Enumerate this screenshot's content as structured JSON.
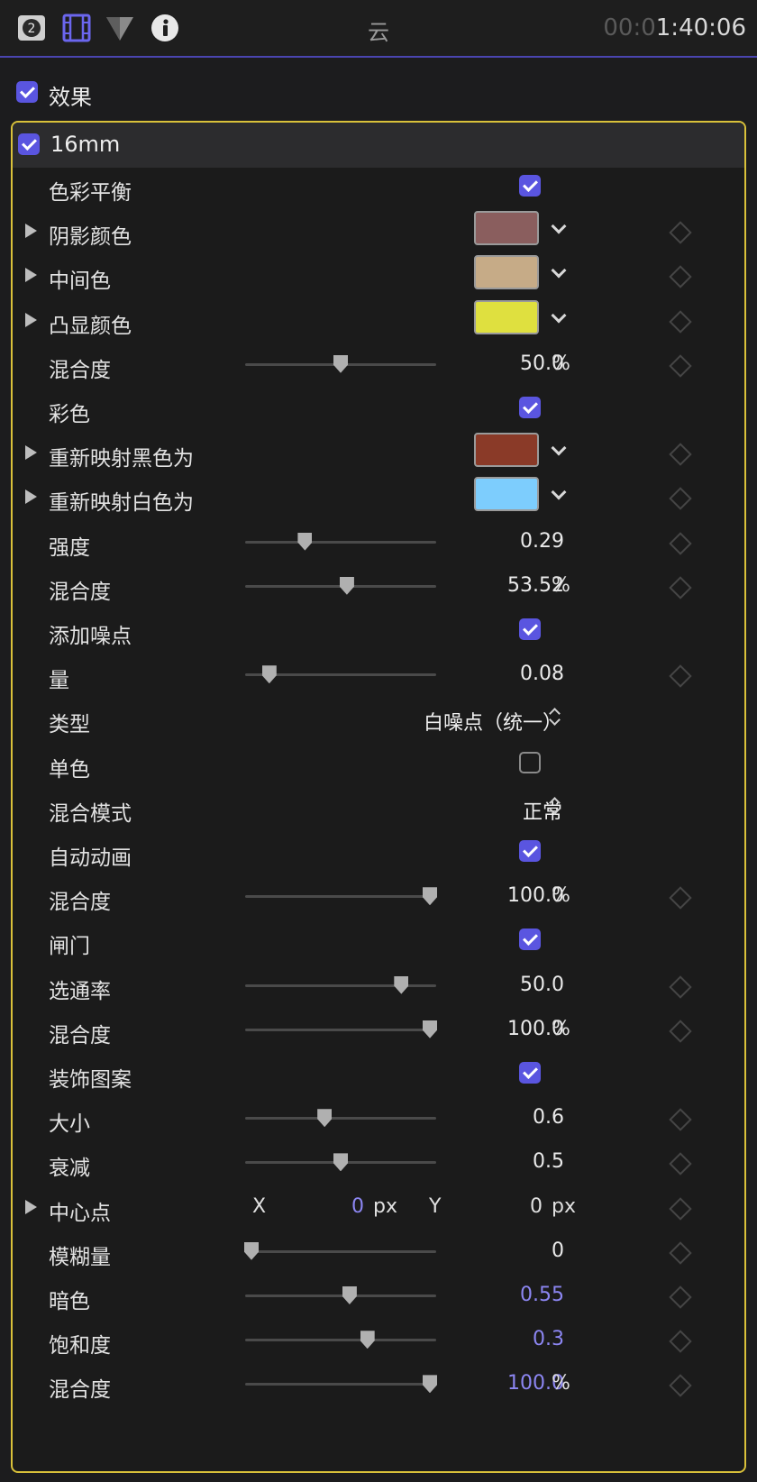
{
  "toolbar": {
    "icons": [
      "badge-2-icon",
      "film-icon",
      "color-triangle-icon",
      "info-icon"
    ],
    "title": "云",
    "timecode_dim": "00:0",
    "timecode": "1:40:06"
  },
  "effects": {
    "label": "效果",
    "checked": true
  },
  "filter": {
    "name": "16mm",
    "checked": true
  },
  "colors": {
    "accent": "#5a55e0",
    "highlight_border": "#d9c13a",
    "link_value": "#8c86f2"
  },
  "rows": [
    {
      "type": "check",
      "label": "色彩平衡",
      "checked": true
    },
    {
      "type": "color",
      "label": "阴影颜色",
      "color": "#8a5e5e",
      "expand": true
    },
    {
      "type": "color",
      "label": "中间色",
      "color": "#c6ab87",
      "expand": true
    },
    {
      "type": "color",
      "label": "凸显颜色",
      "color": "#dfe03f",
      "expand": true
    },
    {
      "type": "slider",
      "label": "混合度",
      "value": "50.0",
      "unit": "%",
      "pos": 0.5
    },
    {
      "type": "check",
      "label": "彩色",
      "checked": true
    },
    {
      "type": "color",
      "label": "重新映射黑色为",
      "color": "#8a3a28",
      "expand": true
    },
    {
      "type": "color",
      "label": "重新映射白色为",
      "color": "#7dcdfd",
      "expand": true
    },
    {
      "type": "slider",
      "label": "强度",
      "value": "0.29",
      "unit": "",
      "pos": 0.3
    },
    {
      "type": "slider",
      "label": "混合度",
      "value": "53.52",
      "unit": "%",
      "pos": 0.535
    },
    {
      "type": "check",
      "label": "添加噪点",
      "checked": true
    },
    {
      "type": "slider",
      "label": "量",
      "value": "0.08",
      "unit": "",
      "pos": 0.1
    },
    {
      "type": "popup",
      "label": "类型",
      "value": "白噪点（统一）"
    },
    {
      "type": "check",
      "label": "单色",
      "checked": false
    },
    {
      "type": "popup",
      "label": "混合模式",
      "value": "正常"
    },
    {
      "type": "check",
      "label": "自动动画",
      "checked": true
    },
    {
      "type": "slider",
      "label": "混合度",
      "value": "100.0",
      "unit": "%",
      "pos": 1.0
    },
    {
      "type": "check",
      "label": "闸门",
      "checked": true
    },
    {
      "type": "slider",
      "label": "选通率",
      "value": "50.0",
      "unit": "",
      "pos": 0.84
    },
    {
      "type": "slider",
      "label": "混合度",
      "value": "100.0",
      "unit": "%",
      "pos": 1.0
    },
    {
      "type": "check",
      "label": "装饰图案",
      "checked": true
    },
    {
      "type": "slider",
      "label": "大小",
      "value": "0.6",
      "unit": "",
      "pos": 0.41
    },
    {
      "type": "slider",
      "label": "衰减",
      "value": "0.5",
      "unit": "",
      "pos": 0.5
    },
    {
      "type": "point",
      "label": "中心点",
      "x_label": "X",
      "x_value": "0",
      "x_unit": "px",
      "y_label": "Y",
      "y_value": "0",
      "y_unit": "px",
      "expand": true
    },
    {
      "type": "slider",
      "label": "模糊量",
      "value": "0",
      "unit": "",
      "pos": 0.0
    },
    {
      "type": "slider",
      "label": "暗色",
      "value": "0.55",
      "unit": "",
      "pos": 0.55,
      "blue": true
    },
    {
      "type": "slider",
      "label": "饱和度",
      "value": "0.3",
      "unit": "",
      "pos": 0.65,
      "blue": true
    },
    {
      "type": "slider",
      "label": "混合度",
      "value": "100.0",
      "unit": "%",
      "pos": 1.0,
      "blue": true
    }
  ]
}
